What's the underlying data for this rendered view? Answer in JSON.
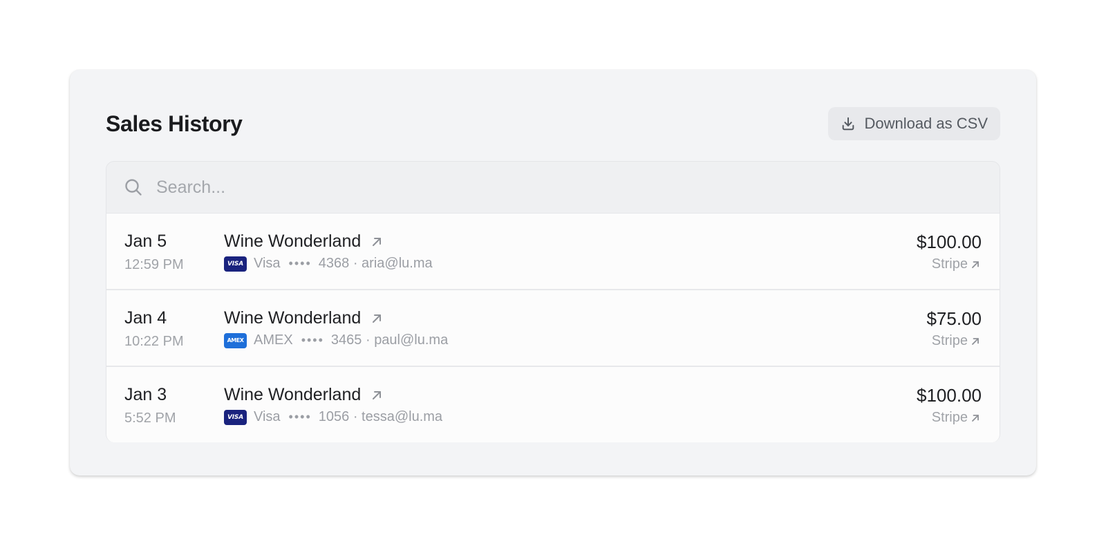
{
  "header": {
    "title": "Sales History",
    "download_label": "Download as CSV",
    "download_icon": "download-icon"
  },
  "search": {
    "placeholder": "Search...",
    "icon": "search-icon"
  },
  "sales": [
    {
      "date": "Jan 5",
      "time": "12:59 PM",
      "event": "Wine Wonderland",
      "card_brand": "Visa",
      "card_badge": "VISA",
      "card_dots": "••••",
      "card_last4": "4368",
      "email": "aria@lu.ma",
      "amount": "$100.00",
      "provider": "Stripe"
    },
    {
      "date": "Jan 4",
      "time": "10:22 PM",
      "event": "Wine Wonderland",
      "card_brand": "AMEX",
      "card_badge": "AMEX",
      "card_dots": "••••",
      "card_last4": "3465",
      "email": "paul@lu.ma",
      "amount": "$75.00",
      "provider": "Stripe"
    },
    {
      "date": "Jan 3",
      "time": "5:52 PM",
      "event": "Wine Wonderland",
      "card_brand": "Visa",
      "card_badge": "VISA",
      "card_dots": "••••",
      "card_last4": "1056",
      "email": "tessa@lu.ma",
      "amount": "$100.00",
      "provider": "Stripe"
    }
  ],
  "colors": {
    "visa": "#1a237e",
    "amex": "#1e6fd9",
    "card_bg": "#f3f4f6",
    "row_bg": "#fcfcfc",
    "muted_text": "#a0a3a8"
  },
  "separator": "·"
}
